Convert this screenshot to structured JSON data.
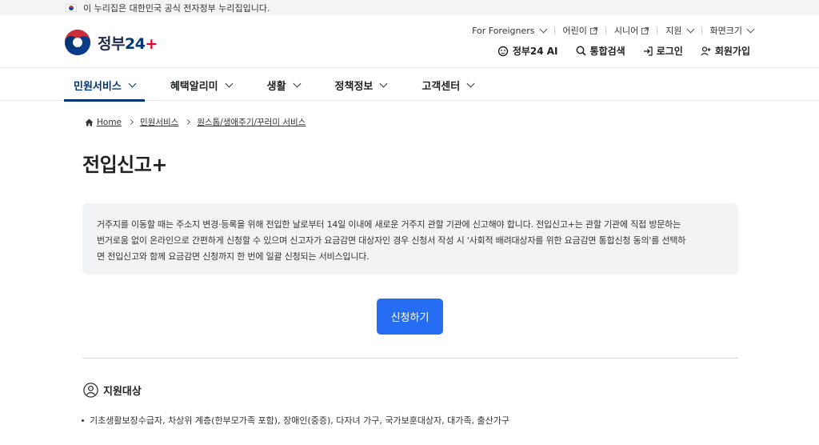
{
  "gov_banner": {
    "text": "이 누리집은 대한민국 공식 전자정부 누리집입니다."
  },
  "logo": {
    "name": "정부",
    "num": "24",
    "plus": "+"
  },
  "util_top": [
    {
      "label": "For Foreigners",
      "kind": "dropdown"
    },
    {
      "label": "어린이",
      "kind": "external"
    },
    {
      "label": "시니어",
      "kind": "external"
    },
    {
      "label": "지원",
      "kind": "dropdown"
    },
    {
      "label": "화면크기",
      "kind": "dropdown"
    }
  ],
  "util_bottom": {
    "ai": "정부24 AI",
    "search": "통합검색",
    "login": "로그인",
    "signup": "회원가입"
  },
  "nav": [
    {
      "label": "민원서비스",
      "active": true
    },
    {
      "label": "혜택알리미",
      "active": false
    },
    {
      "label": "생활",
      "active": false
    },
    {
      "label": "정책정보",
      "active": false
    },
    {
      "label": "고객센터",
      "active": false
    }
  ],
  "breadcrumb": [
    "Home",
    "민원서비스",
    "원스톱/생애주기/꾸러미 서비스"
  ],
  "page_title": "전입신고+",
  "description": {
    "line1": "거주지를 이동할 때는 주소지 변경·등록을 위해 전입한 날로부터 14일 이내에 새로운 거주지 관할 기관에 신고해야 합니다. 전입신고+는 관할 기관에 직접 방문하는",
    "line2": "번거로움 없이 온라인으로 간편하게 신청할 수 있으며 신고자가 요금감면 대상자인 경우 신청서 작성 시 '사회적 배려대상자를 위한 요금감면 통합신청 동의'를 선택하",
    "line3": "면 전입신고와 함께 요금감면 신청까지 한 번에 일괄 신청되는 서비스입니다."
  },
  "apply_button": "신청하기",
  "section": {
    "title": "지원대상",
    "items": [
      "기초생활보장수급자, 차상위 계층(한부모가족 포함), 장애인(중증), 다자녀 가구, 국가보훈대상자, 대가족, 출산가구"
    ]
  },
  "colors": {
    "primary": "#256ef4",
    "navy": "#003675",
    "box_bg": "#f1f3f5"
  }
}
